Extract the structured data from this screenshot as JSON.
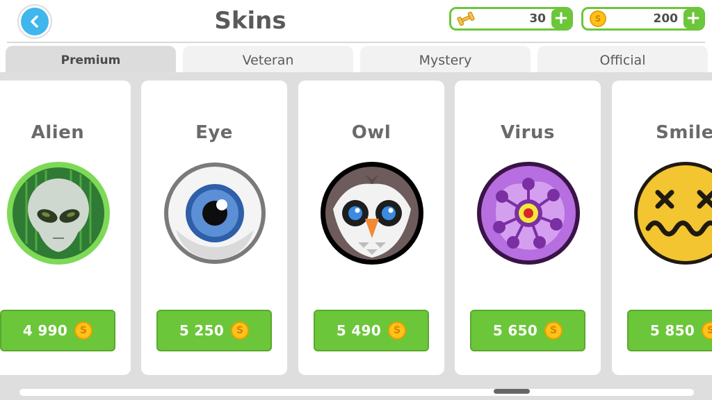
{
  "header": {
    "title": "Skins",
    "back_icon": "back-arrow-icon",
    "currencies": [
      {
        "icon": "dumbbell-icon",
        "value": "30",
        "add_icon": "plus-icon"
      },
      {
        "icon": "coin-icon",
        "value": "200",
        "add_icon": "plus-icon"
      }
    ]
  },
  "tabs": [
    {
      "label": "Premium",
      "active": true
    },
    {
      "label": "Veteran",
      "active": false
    },
    {
      "label": "Mystery",
      "active": false
    },
    {
      "label": "Official",
      "active": false
    }
  ],
  "skins": [
    {
      "name": "Alien",
      "price": "4 990",
      "icon": "alien-skin"
    },
    {
      "name": "Eye",
      "price": "5 250",
      "icon": "eye-skin"
    },
    {
      "name": "Owl",
      "price": "5 490",
      "icon": "owl-skin"
    },
    {
      "name": "Virus",
      "price": "5 650",
      "icon": "virus-skin"
    },
    {
      "name": "Smile",
      "price": "5 850",
      "icon": "smile-skin"
    }
  ],
  "colors": {
    "accent_green": "#6cc63a",
    "back_blue": "#3fb6ec",
    "coin_gold": "#ffc21a"
  }
}
